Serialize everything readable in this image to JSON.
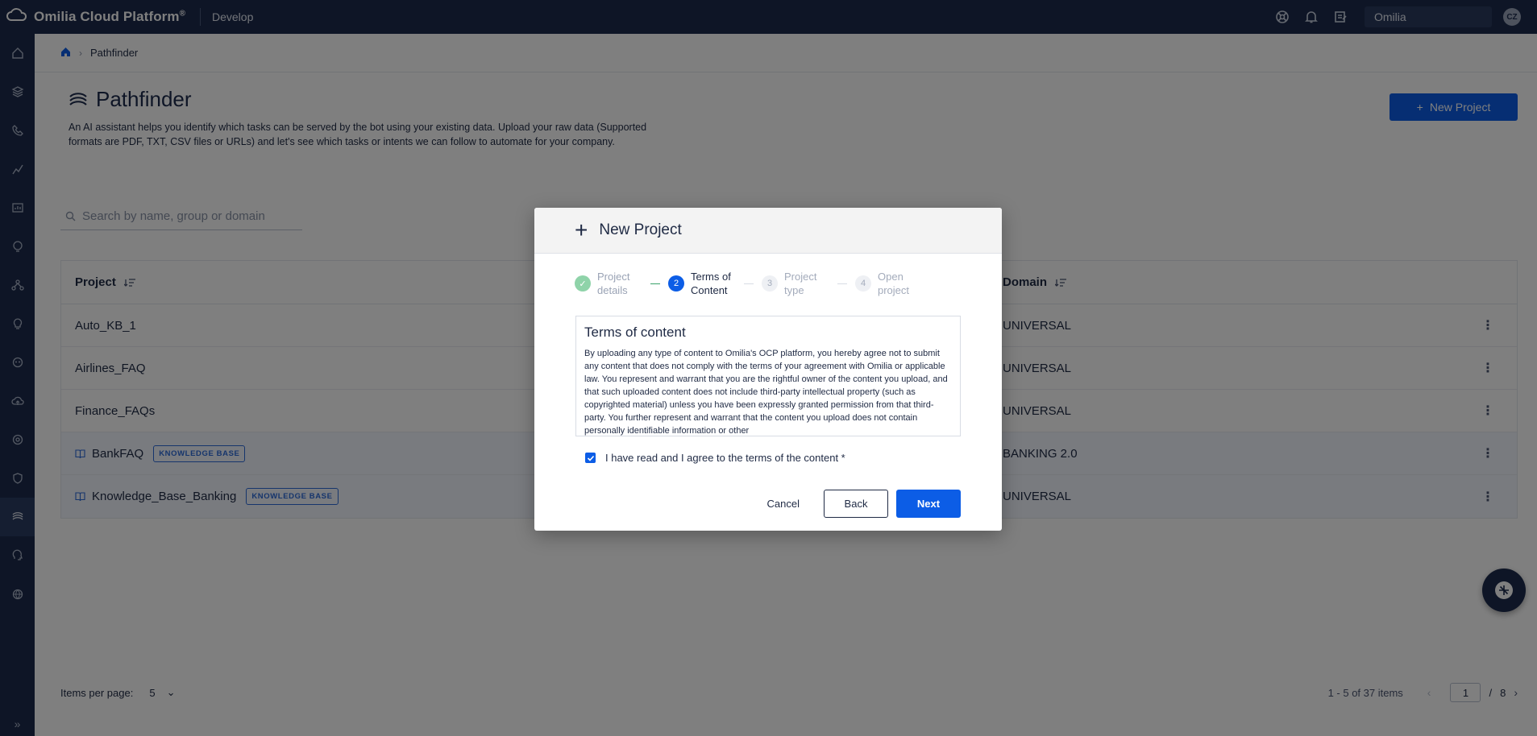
{
  "app": {
    "title": "Omilia Cloud Platform",
    "registered": "®",
    "nav_section": "Develop",
    "org_selector": "Omilia",
    "avatar_initials": "CZ"
  },
  "sidebar": {
    "items": [
      {
        "icon": "home-icon"
      },
      {
        "icon": "layers-icon"
      },
      {
        "icon": "phone-icon"
      },
      {
        "icon": "analytics-icon"
      },
      {
        "icon": "dashboard-icon"
      },
      {
        "icon": "voice-icon"
      },
      {
        "icon": "flow-icon"
      },
      {
        "icon": "bulb-icon"
      },
      {
        "icon": "bot-icon"
      },
      {
        "icon": "cloud-upload-icon"
      },
      {
        "icon": "settings-icon"
      },
      {
        "icon": "shield-icon"
      },
      {
        "icon": "pathfinder-icon",
        "active": true
      },
      {
        "icon": "brain-icon"
      },
      {
        "icon": "globe-icon"
      }
    ],
    "expand_glyph": "»"
  },
  "breadcrumb": {
    "current": "Pathfinder"
  },
  "page": {
    "title": "Pathfinder",
    "description": "An AI assistant helps you identify which tasks can be served by the bot using your existing data. Upload your raw data (Supported formats are PDF, TXT, CSV files or URLs) and let's see which tasks or intents we can follow to automate for your company.",
    "new_project_label": "New Project",
    "search_placeholder": "Search by name, group or domain"
  },
  "table": {
    "col_project": "Project",
    "col_domain": "Domain",
    "rows": [
      {
        "name": "Auto_KB_1",
        "domain": "UNIVERSAL",
        "kb": false
      },
      {
        "name": "Airlines_FAQ",
        "domain": "UNIVERSAL",
        "kb": false
      },
      {
        "name": "Finance_FAQs",
        "domain": "UNIVERSAL",
        "kb": false
      },
      {
        "name": "BankFAQ",
        "domain": "BANKING 2.0",
        "kb": true
      },
      {
        "name": "Knowledge_Base_Banking",
        "domain": "UNIVERSAL",
        "kb": true
      }
    ],
    "kb_badge": "KNOWLEDGE BASE",
    "menu_glyph": "⋮"
  },
  "pagination": {
    "items_per_page_label": "Items per page:",
    "items_per_page": "5",
    "range_text": "1 - 5 of 37 items",
    "current_page": "1",
    "separator": "/",
    "total_pages": "8"
  },
  "modal": {
    "title": "New Project",
    "steps": [
      {
        "number": "1",
        "label": "Project details",
        "state": "done"
      },
      {
        "number": "2",
        "label": "Terms of Content",
        "state": "active"
      },
      {
        "number": "3",
        "label": "Project type",
        "state": "todo"
      },
      {
        "number": "4",
        "label": "Open project",
        "state": "todo"
      }
    ],
    "terms_title": "Terms of content",
    "terms_text": "By uploading any type of content to Omilia's OCP platform, you hereby agree not to submit any content that does not comply with the terms of your agreement with Omilia or applicable law. You represent and warrant that you are the rightful owner of the content you upload, and that such uploaded content does not include third-party intellectual property (such as copyrighted material) unless you have been expressly granted permission from that third-party. You further represent and warrant that the content you upload does not contain personally identifiable information or other",
    "agree_label": "I have read and I agree to the terms of the content *",
    "agree_checked": true,
    "cancel_label": "Cancel",
    "back_label": "Back",
    "next_label": "Next"
  },
  "colors": {
    "brand_navy": "#1c2b4d",
    "primary_blue": "#0c5de6",
    "success_green": "#8fd3a9"
  }
}
